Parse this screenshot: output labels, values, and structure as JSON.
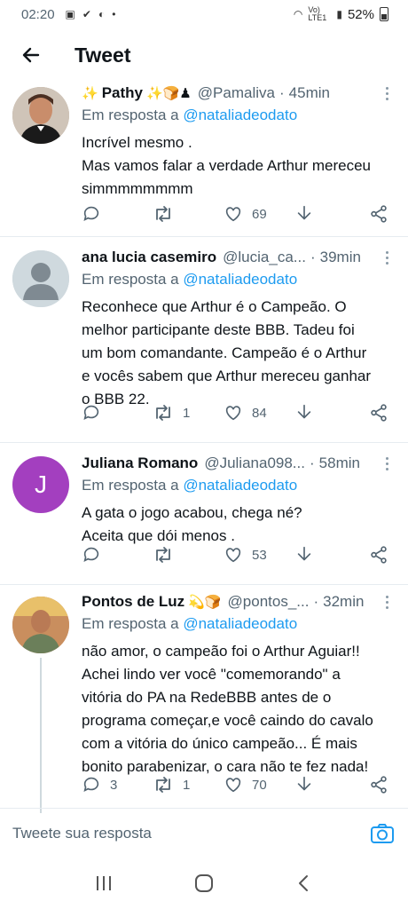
{
  "status_bar": {
    "time": "02:20",
    "network": "Vo) LTE1",
    "battery": "52%"
  },
  "header": {
    "title": "Tweet"
  },
  "tweets": [
    {
      "name": "Pathy",
      "name_prefix": "✨",
      "name_suffix": "✨🍞♟",
      "handle": "@Pamaliva",
      "time": "45min",
      "reply_prefix": "Em resposta a",
      "reply_mention": "@nataliadeodato",
      "text_lines": [
        "Incrível mesmo .",
        "Mas vamos falar a verdade Arthur mereceu",
        "simmmmmmmm"
      ],
      "replies": "",
      "retweets": "",
      "likes": "69"
    },
    {
      "name": "ana lucia casemiro",
      "name_prefix": "",
      "name_suffix": "",
      "handle": "@lucia_ca...",
      "time": "39min",
      "reply_prefix": "Em resposta a",
      "reply_mention": "@nataliadeodato",
      "text_lines": [
        "Reconhece que Arthur é o Campeão. O",
        "melhor participante deste BBB. Tadeu foi",
        "um bom comandante. Campeão é o Arthur",
        "e vocês sabem que Arthur mereceu ganhar",
        "o BBB 22."
      ],
      "replies": "",
      "retweets": "1",
      "likes": "84"
    },
    {
      "name": "Juliana Romano",
      "name_prefix": "",
      "name_suffix": "",
      "handle": "@Juliana098...",
      "time": "58min",
      "avatar_letter": "J",
      "reply_prefix": "Em resposta a",
      "reply_mention": "@nataliadeodato",
      "text_lines": [
        "A gata o jogo acabou, chega né?",
        "Aceita que dói menos ."
      ],
      "replies": "",
      "retweets": "",
      "likes": "53"
    },
    {
      "name": "Pontos de Luz",
      "name_prefix": "",
      "name_suffix": "💫🍞",
      "handle": "@pontos_...",
      "time": "32min",
      "reply_prefix": "Em resposta a",
      "reply_mention": "@nataliadeodato",
      "text_lines": [
        "não amor, o campeão foi o Arthur Aguiar!!",
        "Achei lindo ver você \"comemorando\" a",
        "vitória do PA na RedeBBB antes de o",
        "programa começar,e você caindo do cavalo",
        "com a vitória do único campeão... É mais",
        "bonito parabenizar, o cara não te fez nada!"
      ],
      "replies": "3",
      "retweets": "1",
      "likes": "70"
    }
  ],
  "composer": {
    "placeholder": "Tweete sua resposta"
  },
  "colors": {
    "accent": "#1d9bf0",
    "secondary_text": "#536471",
    "juliana_avatar": "#a33fbf"
  },
  "icons": [
    "back-arrow-icon",
    "reply-icon",
    "retweet-icon",
    "like-icon",
    "download-icon",
    "share-icon",
    "more-icon",
    "camera-icon",
    "recents-icon",
    "home-icon",
    "back-nav-icon"
  ]
}
